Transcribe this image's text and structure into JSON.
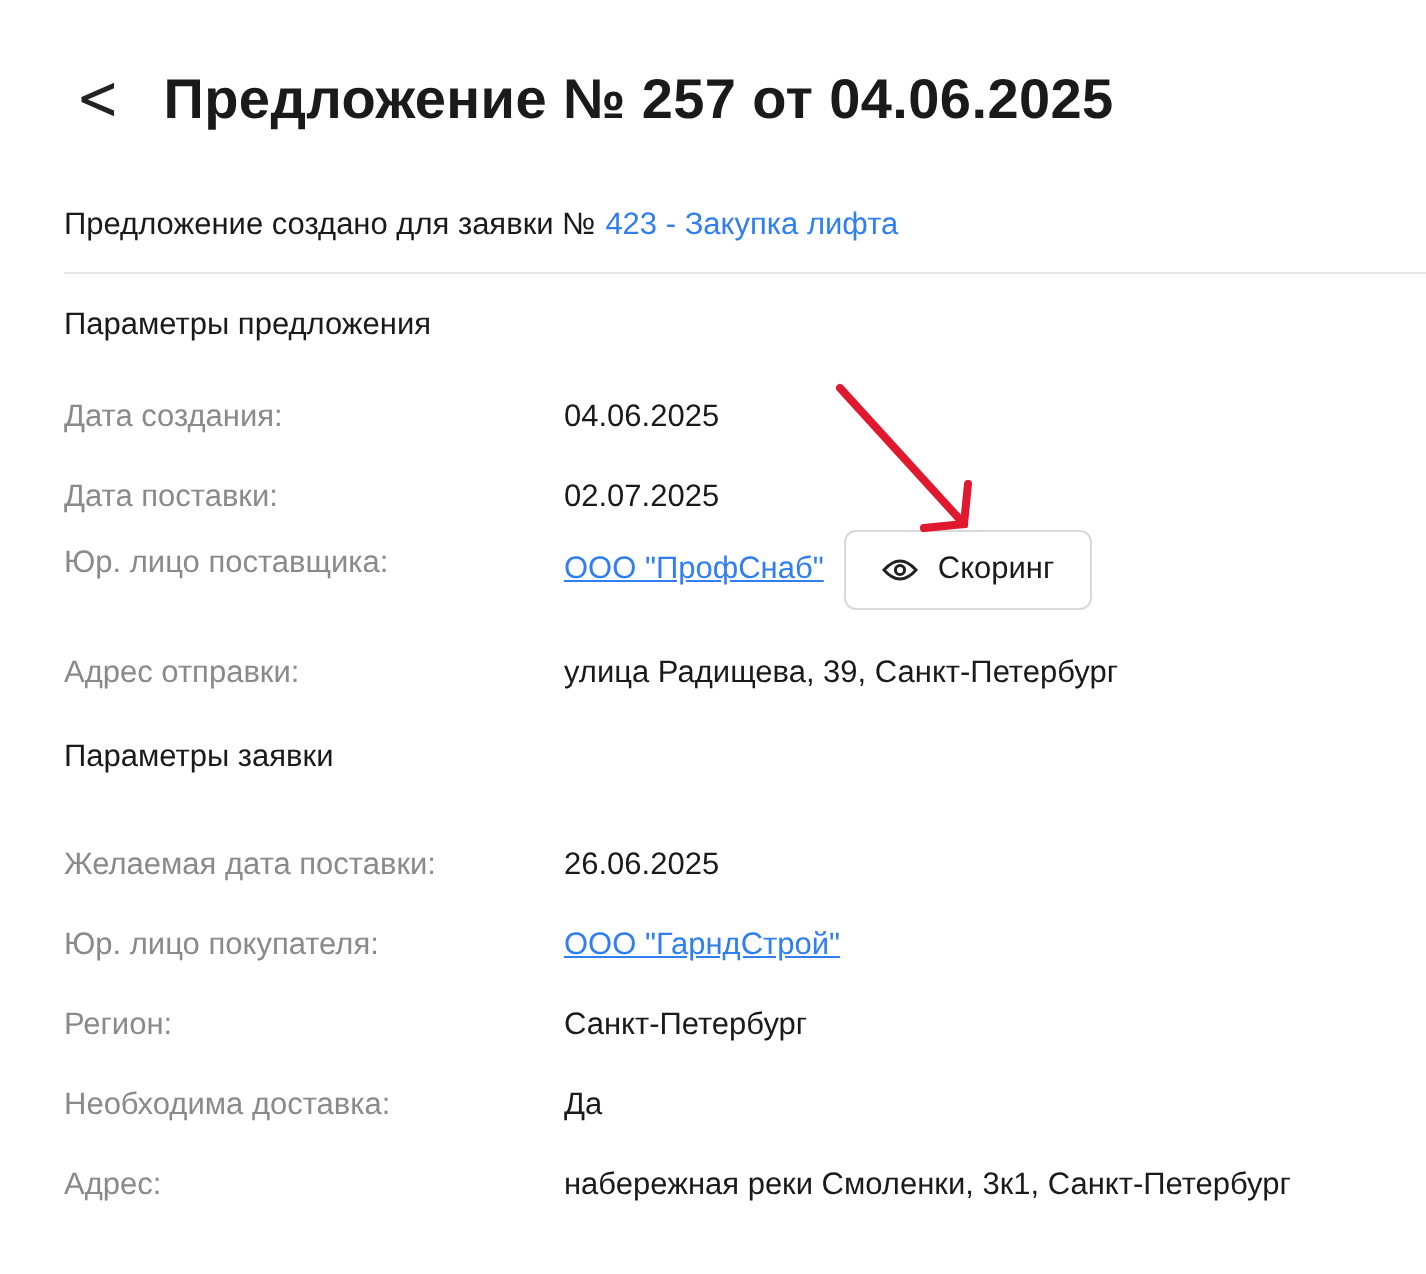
{
  "header": {
    "back": "<",
    "title": "Предложение № 257 от 04.06.2025"
  },
  "intro": {
    "text": "Предложение создано для заявки №",
    "link": "423 - Закупка лифта"
  },
  "sections": [
    {
      "title": "Параметры предложения",
      "rows": [
        {
          "label": "Дата создания:",
          "kind": "text",
          "value": "04.06.2025"
        },
        {
          "label": "Дата поставки:",
          "kind": "text",
          "value": "02.07.2025"
        },
        {
          "label": "Юр. лицо поставщика:",
          "kind": "link_button",
          "value": "ООО \"ПрофСнаб\"",
          "button": "Скоринг"
        },
        {
          "label": "Адрес отправки:",
          "kind": "text",
          "value": "улица Радищева, 39, Санкт-Петербург"
        }
      ]
    },
    {
      "title": "Параметры заявки",
      "rows": [
        {
          "label": "Желаемая дата поставки:",
          "kind": "text",
          "value": "26.06.2025"
        },
        {
          "label": "Юр. лицо покупателя:",
          "kind": "link",
          "value": "ООО \"ГарндСтрой\""
        },
        {
          "label": "Регион:",
          "kind": "text",
          "value": "Санкт-Петербург"
        },
        {
          "label": "Необходима доставка:",
          "kind": "text",
          "value": "Да"
        },
        {
          "label": "Адрес:",
          "kind": "text",
          "value": "набережная реки Смоленки, 3к1, Санкт-Петербург"
        }
      ]
    }
  ]
}
